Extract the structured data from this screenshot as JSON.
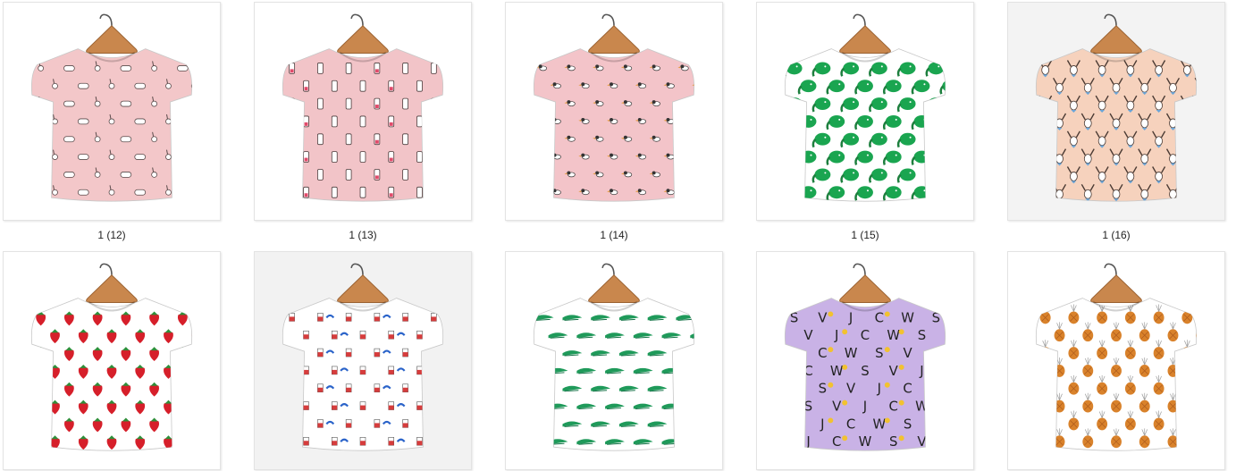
{
  "thumbnails": [
    {
      "caption": "1 (12)",
      "shirt_color": "#f3c7c9",
      "bg": "#ffffff",
      "pattern": "bunnies-bottles",
      "print_color": "#5a4a4a",
      "accent": "#e8dcd4"
    },
    {
      "caption": "1 (13)",
      "shirt_color": "#f2c4c8",
      "bg": "#ffffff",
      "pattern": "bottles-plants",
      "print_color": "#4a3b3b",
      "accent": "#f0e9df"
    },
    {
      "caption": "1 (14)",
      "shirt_color": "#f3c4c9",
      "bg": "#ffffff",
      "pattern": "birds",
      "print_color": "#333333",
      "accent": "#e39a3f"
    },
    {
      "caption": "1 (15)",
      "shirt_color": "#ffffff",
      "bg": "#ffffff",
      "pattern": "elephants",
      "print_color": "#1aa550",
      "accent": "#1d7f3e"
    },
    {
      "caption": "1 (16)",
      "shirt_color": "#f6d2bd",
      "bg": "#f3f3f3",
      "pattern": "deer",
      "print_color": "#4a3a33",
      "accent": "#6aa5d8"
    },
    {
      "caption": "",
      "shirt_color": "#ffffff",
      "bg": "#ffffff",
      "pattern": "strawberries",
      "print_color": "#d61f2a",
      "accent": "#2f8f3a"
    },
    {
      "caption": "",
      "shirt_color": "#ffffff",
      "bg": "#f2f2f2",
      "pattern": "drinks",
      "print_color": "#d63c3c",
      "accent": "#2a63c9"
    },
    {
      "caption": "",
      "shirt_color": "#ffffff",
      "bg": "#ffffff",
      "pattern": "crocodiles",
      "print_color": "#1f9a5a",
      "accent": "#157347"
    },
    {
      "caption": "",
      "shirt_color": "#c9b2e6",
      "bg": "#ffffff",
      "pattern": "letters",
      "print_color": "#222222",
      "accent": "#f2c230"
    },
    {
      "caption": "",
      "shirt_color": "#ffffff",
      "bg": "#ffffff",
      "pattern": "pineapples",
      "print_color": "#d9822b",
      "accent": "#9b9b9b"
    }
  ]
}
